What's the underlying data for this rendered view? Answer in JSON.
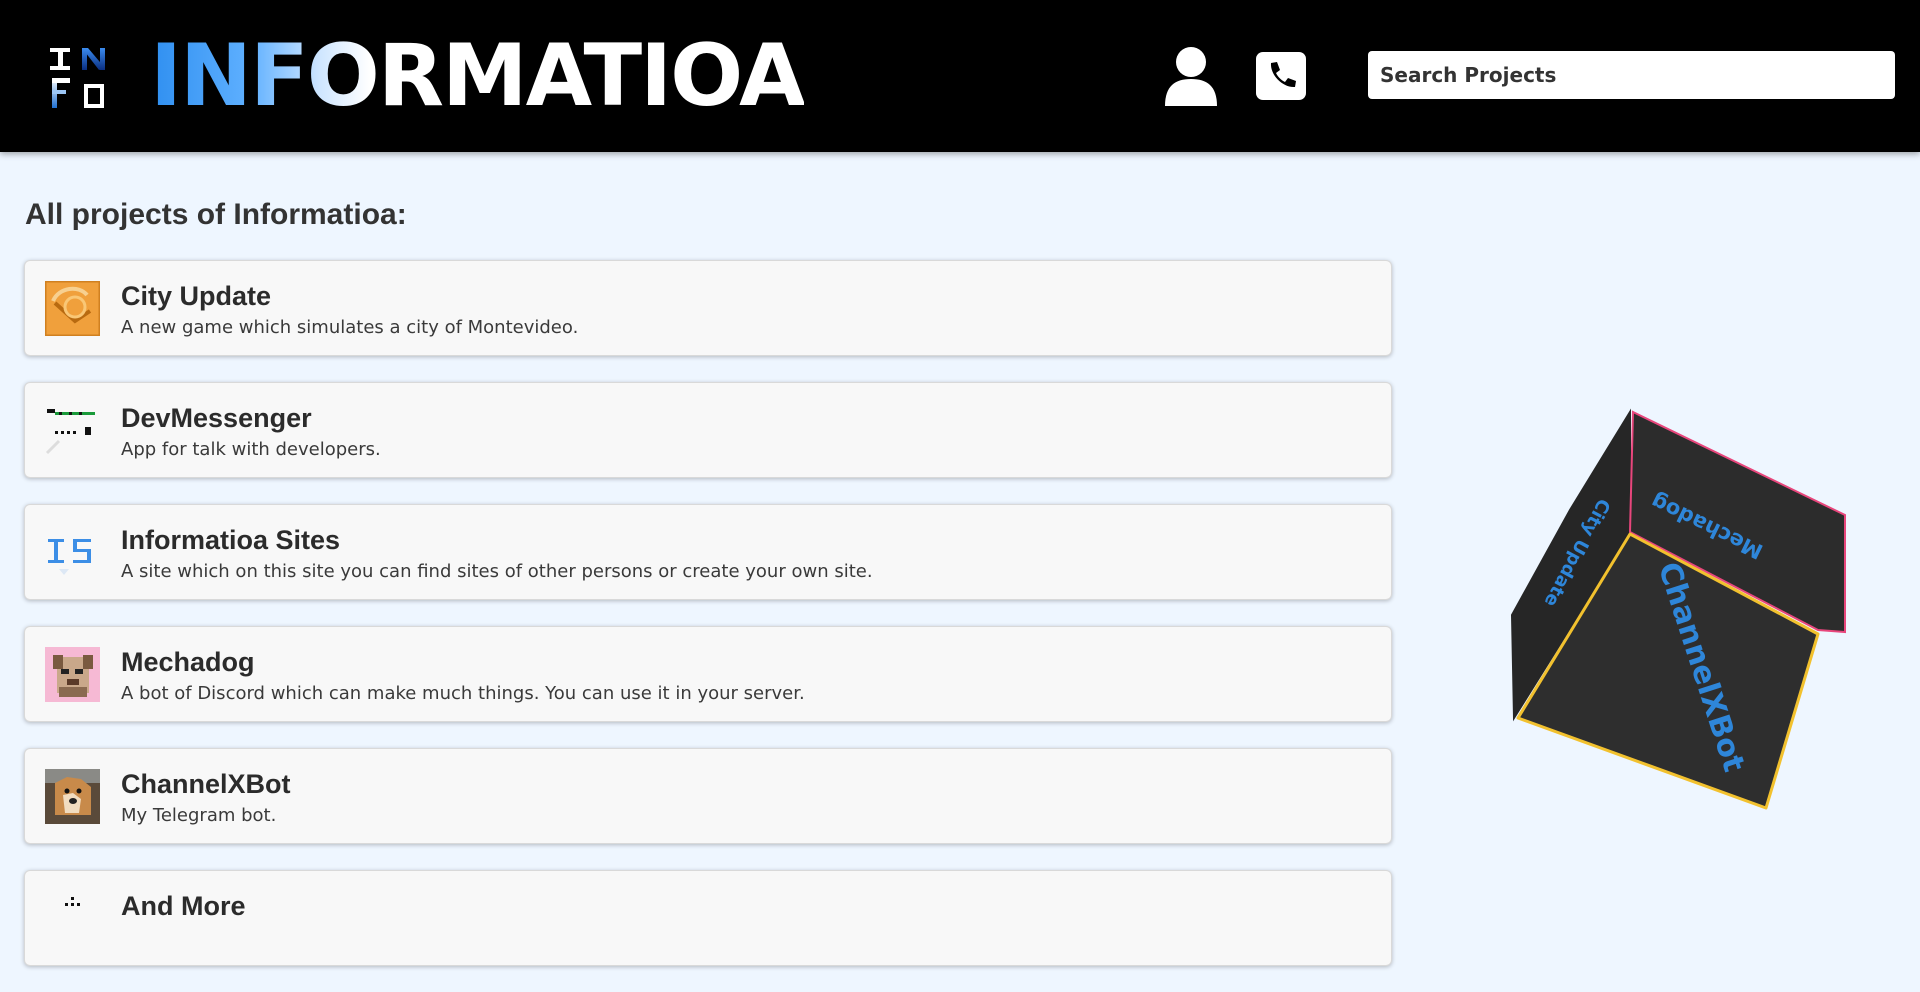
{
  "header": {
    "brand": "INFORMATIOA",
    "logo_letters": [
      "I",
      "N",
      "F",
      "O"
    ],
    "search_placeholder": "Search Projects"
  },
  "main": {
    "title": "All projects of Informatioa:",
    "projects": [
      {
        "name": "City Update",
        "description": "A new game which simulates a city of Montevideo.",
        "icon": "city-update-icon"
      },
      {
        "name": "DevMessenger",
        "description": "App for talk with developers.",
        "icon": "devmessenger-icon"
      },
      {
        "name": "Informatioa Sites",
        "description": "A site which on this site you can find sites of other persons or create your own site.",
        "icon": "informatioa-sites-icon"
      },
      {
        "name": "Mechadog",
        "description": "A bot of Discord which can make much things. You can use it in your server.",
        "icon": "mechadog-icon"
      },
      {
        "name": "ChannelXBot",
        "description": "My Telegram bot.",
        "icon": "channelxbot-icon"
      },
      {
        "name": "And More",
        "description": "",
        "icon": "and-more-icon"
      }
    ]
  },
  "cube": {
    "faces": [
      "ChannelXBot",
      "Mechadog",
      "City Update"
    ],
    "colors": {
      "face": "#2b2b2b",
      "text": "#2e86d9",
      "edge_front": "#f2c12e",
      "edge_top": "#e8467c"
    }
  }
}
